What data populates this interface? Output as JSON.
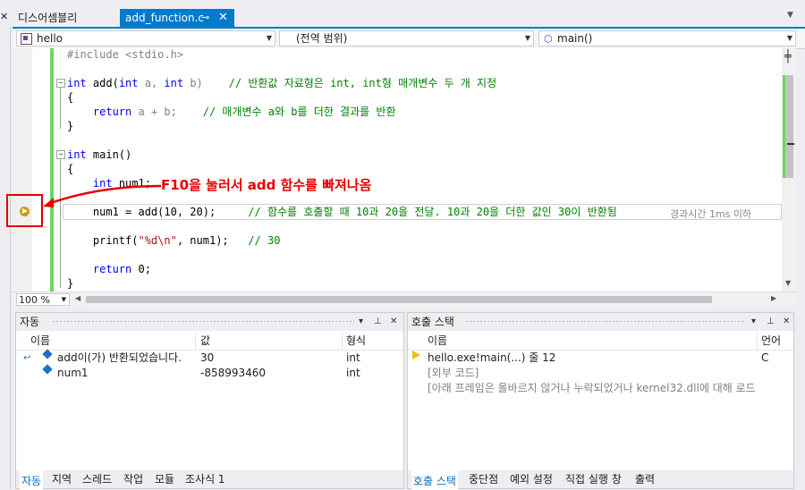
{
  "tabs": {
    "inactive": "디스어셈블리",
    "active": "add_function.c",
    "pin": "⊸",
    "close": "✕"
  },
  "left_strip_close": "✕",
  "navbar": {
    "project": "hello",
    "scope": "(전역 범위)",
    "function": "main()"
  },
  "code": {
    "l1": "#include <stdio.h>",
    "l3_kw1": "int",
    "l3_a": " add(",
    "l3_kw2": "int",
    "l3_p1": " a, ",
    "l3_kw3": "int",
    "l3_p2": " b)    ",
    "l3_cm": "// 반환값 자료형은 int, int형 매개변수 두 개 지정",
    "l4": "{",
    "l5_kw": "return",
    "l5_rest": " a + b;    ",
    "l5_cm": "// 매개변수 a와 b를 더한 결과를 반환",
    "l6": "}",
    "l8_kw": "int",
    "l8_rest": " main()",
    "l9": "{",
    "l10_kw": "int",
    "l10_rest": " num1;",
    "l12_code": "num1 = add(10, 20);     ",
    "l12_cm": "// 함수를 호출할 때 10과 20을 전달. 10과 20을 더한 값인 30이 반환됨",
    "l14_a": "printf(",
    "l14_str": "\"%d\\n\"",
    "l14_b": ", num1);   ",
    "l14_cm": "// 30",
    "l16_kw": "return",
    "l16_rest": " 0;",
    "l17": "}"
  },
  "elapsed": "경과시간 1ms 이하",
  "annotation": "F10을 눌러서 add 함수를 빠져나옴",
  "zoom": "100 %",
  "autos": {
    "title": "자동",
    "columns": [
      "이름",
      "값",
      "형식"
    ],
    "rows": [
      {
        "name": "add이(가) 반환되었습니다.",
        "value": "30",
        "type": "int"
      },
      {
        "name": "num1",
        "value": "-858993460",
        "type": "int"
      }
    ],
    "tabs": [
      "자동",
      "지역",
      "스레드",
      "작업",
      "모듈",
      "조사식 1"
    ]
  },
  "callstack": {
    "title": "호출 스택",
    "columns": [
      "이름",
      "언어"
    ],
    "rows": [
      {
        "name": "hello.exe!main(...) 줄 12",
        "lang": "C"
      },
      {
        "name": "[외부 코드]",
        "lang": ""
      },
      {
        "name": "[아래 프레임은 올바르지 않거나 누락되었거나 kernel32.dll에 대해 로드",
        "lang": ""
      }
    ],
    "tabs": [
      "호출 스택",
      "중단점",
      "예외 설정",
      "직접 실행 창",
      "출력"
    ]
  },
  "panel_buttons": {
    "dropdown": "▾",
    "pin": "⊥",
    "close": "✕"
  },
  "colors": {
    "accent": "#007acc",
    "annotation": "#e60000",
    "change_bar": "#6fd65a"
  }
}
